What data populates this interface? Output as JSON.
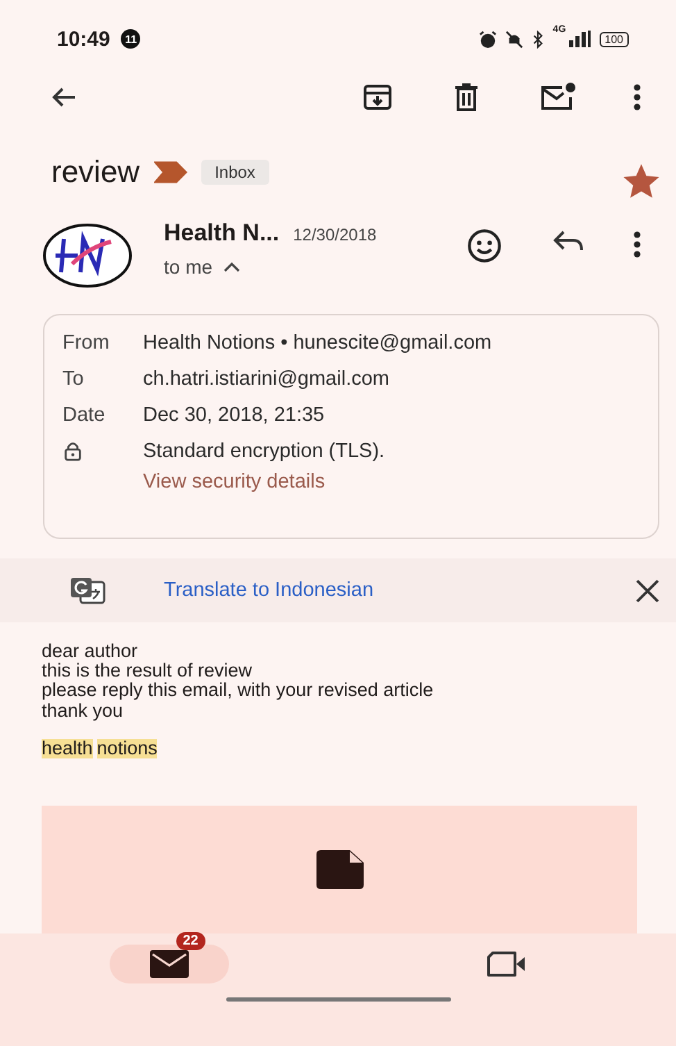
{
  "status_bar": {
    "time": "10:49",
    "notification_count": "11",
    "network": "4G",
    "battery": "100"
  },
  "subject": {
    "title": "review",
    "label": "Inbox",
    "important": true,
    "starred": true
  },
  "sender": {
    "name": "Health N...",
    "date": "12/30/2018",
    "recipient": "to me",
    "expanded": true
  },
  "details": [
    {
      "label": "From",
      "value": "Health Notions • hunescite@gmail.com"
    },
    {
      "label": "To",
      "value": "ch.hatri.istiarini@gmail.com"
    },
    {
      "label": "Date",
      "value": "Dec 30, 2018, 21:35"
    }
  ],
  "security": {
    "text": "Standard encryption (TLS).",
    "link": "View security details"
  },
  "translate": {
    "text": "Translate to Indonesian"
  },
  "body": {
    "lines": [
      "dear author",
      "this is the result of review",
      "please reply this email, with your revised article",
      "thank you"
    ],
    "signature": [
      "health",
      "notions"
    ]
  },
  "bottom_nav": [
    {
      "kind": "mail",
      "selected": true,
      "badge": "22"
    },
    {
      "kind": "video",
      "selected": false
    }
  ]
}
